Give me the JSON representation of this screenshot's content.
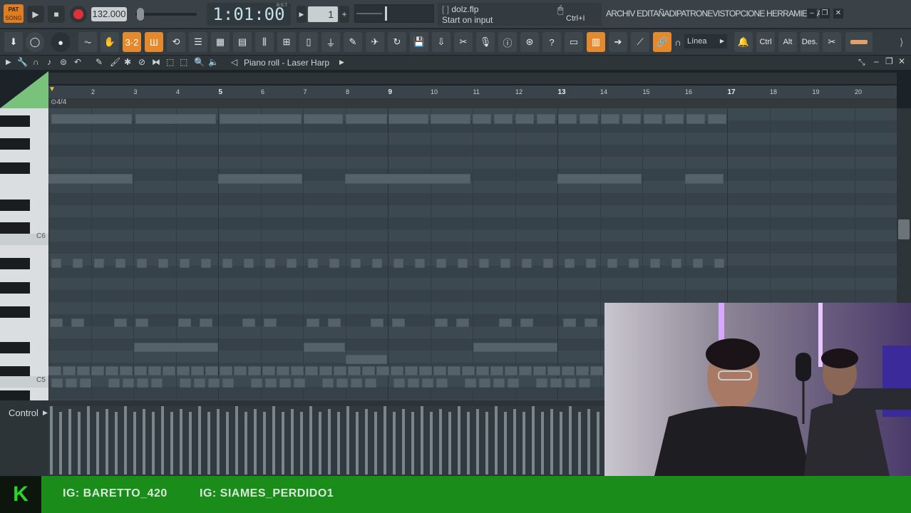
{
  "transport": {
    "pat_label": "PAT",
    "song_label": "SONG",
    "tempo": "132.000",
    "time": "1:01:00",
    "time_unit": "B:S:T",
    "pattern_number": "1"
  },
  "hint": {
    "file": "dolz.flp",
    "message": "Start on input",
    "shortcut": "Ctrl+I"
  },
  "menu": {
    "text": "ARCHIV EDITAÑADIPATRONEVISTOPCIONE HERRAMIENTAY"
  },
  "toolbar": {
    "snap_value": "Línea",
    "ctrl_label": "Ctrl",
    "alt_label": "Alt",
    "des_label": "Des."
  },
  "piano_roll": {
    "title": "Piano roll - Laser Harp",
    "time_signature": "4/4",
    "key_labels": [
      "C6",
      "C5"
    ]
  },
  "ruler": {
    "bars": [
      "2",
      "3",
      "4",
      "5",
      "6",
      "7",
      "8",
      "9",
      "10",
      "11",
      "12",
      "13",
      "14",
      "15",
      "16",
      "17",
      "18",
      "19",
      "20"
    ]
  },
  "control": {
    "label": "Control"
  },
  "overlay": {
    "logo_letter": "K",
    "ig1": "IG: BARETTO_420",
    "ig2": "IG: SIAMES_PERDIDO1"
  },
  "colors": {
    "accent_orange": "#e58a2c",
    "record_red": "#e0303a",
    "grid_bg": "#3a454c",
    "note_color": "#55626a",
    "banner_green": "#1a8c1a"
  }
}
